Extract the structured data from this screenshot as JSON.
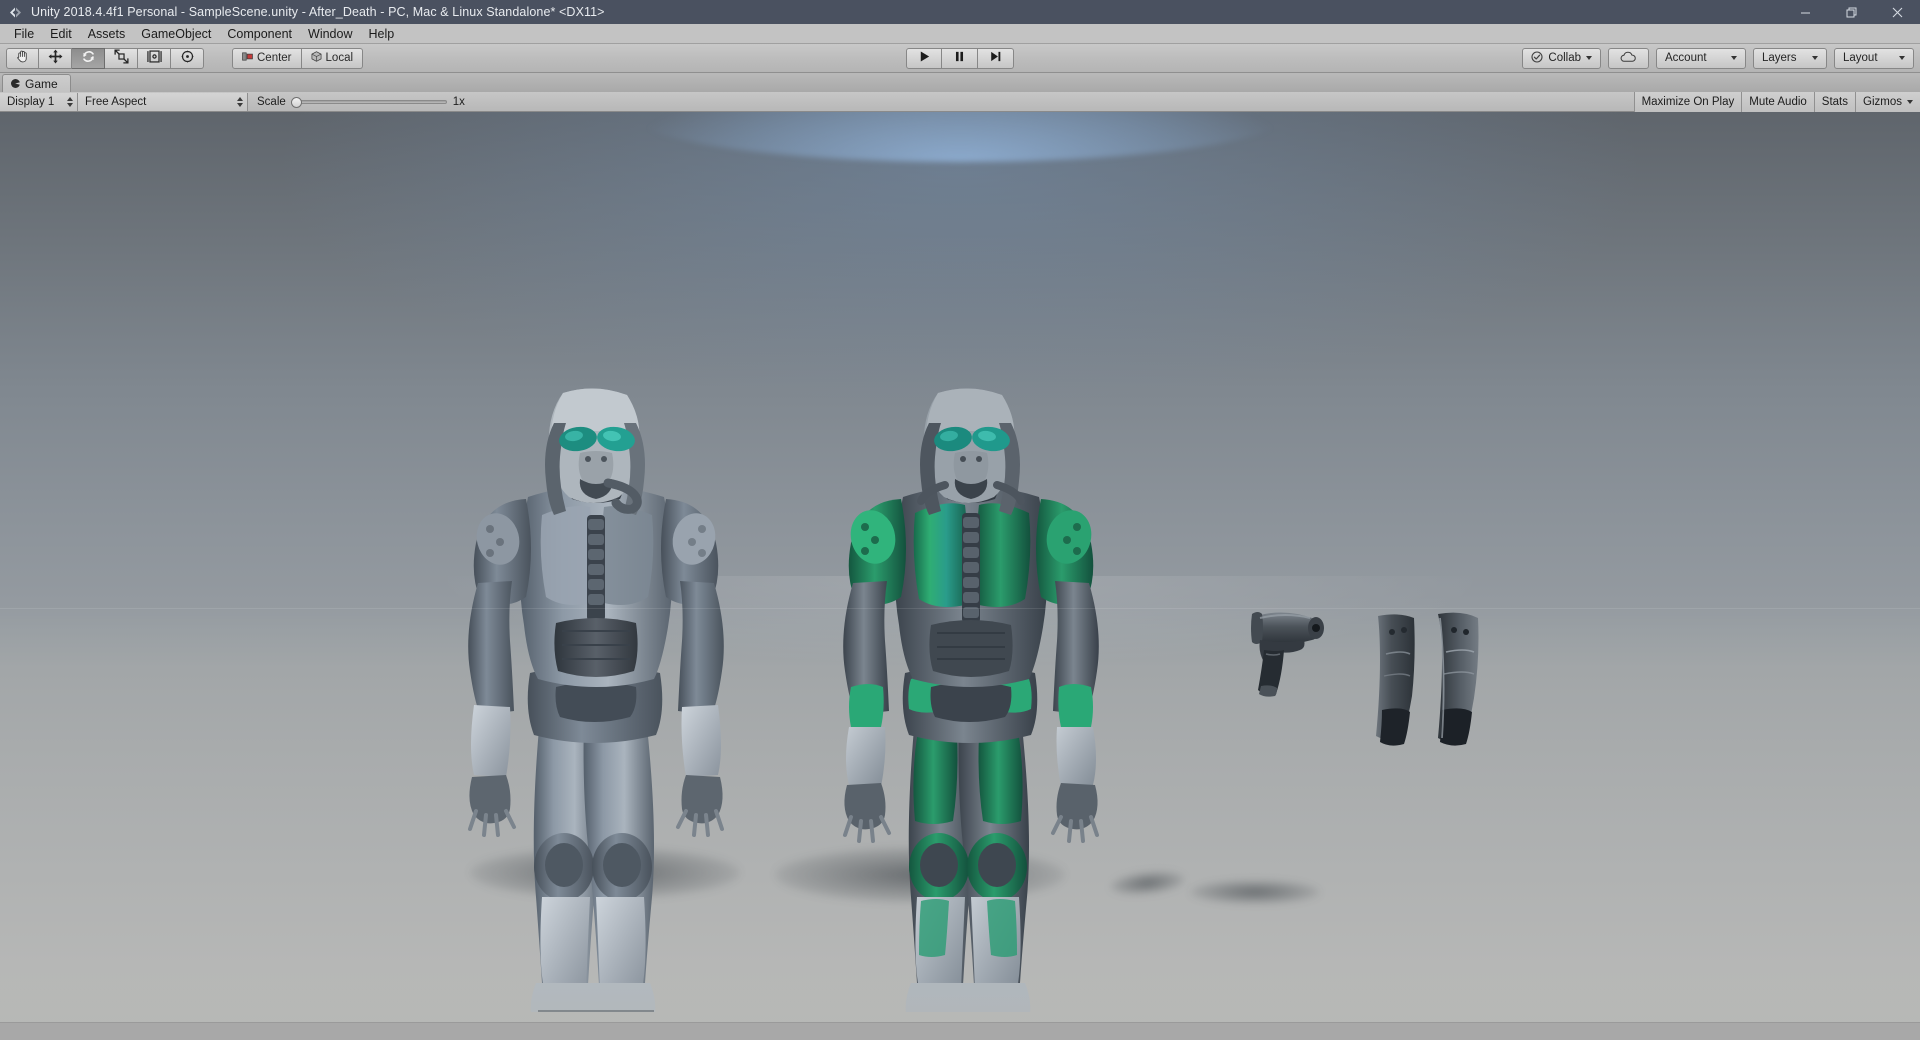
{
  "window": {
    "title": "Unity 2018.4.4f1 Personal - SampleScene.unity - After_Death - PC, Mac & Linux Standalone* <DX11>",
    "logo_icon": "unity-logo-icon",
    "minimize_label": "–",
    "restore_label": "❐",
    "close_label": "✕"
  },
  "menubar": {
    "items": [
      {
        "label": "File"
      },
      {
        "label": "Edit"
      },
      {
        "label": "Assets"
      },
      {
        "label": "GameObject"
      },
      {
        "label": "Component"
      },
      {
        "label": "Window"
      },
      {
        "label": "Help"
      }
    ]
  },
  "toolbar": {
    "transform_tools": [
      {
        "name": "hand-tool",
        "icon": "hand-icon",
        "active": false
      },
      {
        "name": "move-tool",
        "icon": "move-arrows-icon",
        "active": false
      },
      {
        "name": "rotate-tool",
        "icon": "rotate-icon",
        "active": true
      },
      {
        "name": "scale-tool",
        "icon": "scale-icon",
        "active": false
      },
      {
        "name": "rect-tool",
        "icon": "rect-transform-icon",
        "active": false
      },
      {
        "name": "transform-tool",
        "icon": "move-rotate-scale-icon",
        "active": false
      }
    ],
    "pivot_label": "Center",
    "pivot_icon": "pivot-center-icon",
    "handle_label": "Local",
    "handle_icon": "handle-local-icon",
    "play_label": "▶",
    "pause_label": "❙❙",
    "step_label": "▶|",
    "collab_label": "Collab",
    "collab_icon": "collab-check-icon",
    "cloud_icon": "cloud-icon",
    "account_label": "Account",
    "layers_label": "Layers",
    "layout_label": "Layout"
  },
  "game_panel": {
    "tab_label": "Game",
    "tab_icon": "game-pacman-icon",
    "display": "Display 1",
    "aspect": "Free Aspect",
    "scale_label": "Scale",
    "scale_value": "1x",
    "scale_percent": 0,
    "maximize_on_play": "Maximize On Play",
    "mute_audio": "Mute Audio",
    "stats": "Stats",
    "gizmos": "Gizmos"
  },
  "scene": {
    "background_top_color": "#5f656c",
    "background_bottom_color": "#b9bab8",
    "sky_glow_color": "#8cb3dd",
    "objects": [
      {
        "name": "character-grey-armor",
        "label": "Grey armored cyborg character",
        "accent_color": "#7e8c9b",
        "visor_color": "#1f8f82"
      },
      {
        "name": "character-green-armor",
        "label": "Green armored cyborg character",
        "accent_color": "#2fa06a",
        "visor_color": "#1f8f82"
      },
      {
        "name": "prop-pistol",
        "label": "Sci-fi pistol prop",
        "accent_color": "#4b5158"
      },
      {
        "name": "prop-armor-plates",
        "label": "Pair of armor/holster plates",
        "accent_color": "#535a61"
      }
    ]
  }
}
